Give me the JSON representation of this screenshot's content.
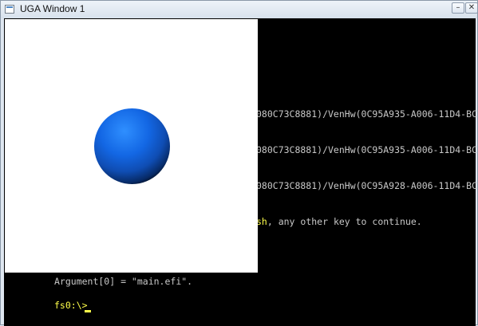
{
  "window": {
    "title": "UGA Window 1",
    "controls": {
      "minimize_glyph": "–",
      "close_glyph": "✕"
    }
  },
  "console": {
    "lines": [
      {
        "text": "080C73C8881)/VenHw(0C95A935-A006-11D4-BC"
      },
      {
        "text": "080C73C8881)/VenHw(0C95A935-A006-11D4-BC"
      },
      {
        "text": "080C73C8881)/VenHw(0C95A928-A006-11D4-BC"
      }
    ],
    "prompt_line": {
      "highlight": "sh",
      "rest": ", any other key to continue."
    },
    "argument_line": "Argument[0] = \"main.efi\".",
    "shell_prompt": "fs0:\\>"
  },
  "colors": {
    "console_bg": "#000000",
    "console_text": "#c8c8c8",
    "console_highlight": "#ffff4a",
    "sphere": "#1367e4"
  },
  "icons": [
    "window-app-icon",
    "minimize-icon",
    "close-icon"
  ]
}
